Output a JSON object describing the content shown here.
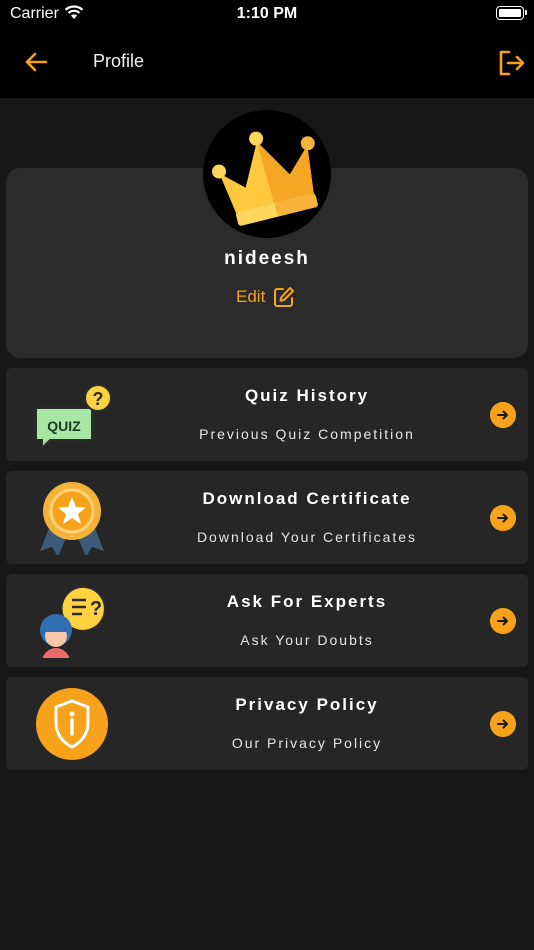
{
  "status": {
    "carrier": "Carrier",
    "time": "1:10 PM"
  },
  "nav": {
    "title": "Profile"
  },
  "profile": {
    "username": "nideesh",
    "edit_label": "Edit"
  },
  "menu": [
    {
      "title": "Quiz History",
      "subtitle": "Previous  Quiz  Competition",
      "icon": "quiz-icon"
    },
    {
      "title": "Download Certificate",
      "subtitle": "Download Your Certificates",
      "icon": "medal-icon"
    },
    {
      "title": "Ask For Experts",
      "subtitle": "Ask Your Doubts",
      "icon": "expert-icon"
    },
    {
      "title": "Privacy Policy",
      "subtitle": "Our Privacy Policy",
      "icon": "shield-info-icon"
    }
  ],
  "colors": {
    "accent": "#f6a21b",
    "background": "#171717",
    "card": "#262626",
    "header": "#000000"
  }
}
